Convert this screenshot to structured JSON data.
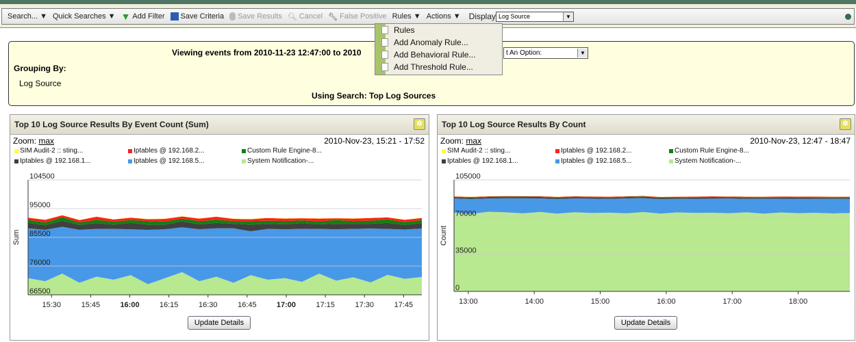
{
  "toolbar": {
    "search": "Search... ▼",
    "quick_searches": "Quick Searches ▼",
    "add_filter": "Add Filter",
    "save_criteria": "Save Criteria",
    "save_results": "Save Results",
    "cancel": "Cancel",
    "false_positive": "False Positive",
    "rules": "Rules ▼",
    "actions": "Actions ▼",
    "display_label": "Display",
    "display_value": "Log Source"
  },
  "rules_menu": {
    "items": [
      "Rules",
      "Add Anomaly Rule...",
      "Add Behavioral Rule...",
      "Add Threshold Rule..."
    ]
  },
  "info": {
    "viewing": "Viewing events from 2010-11-23 12:47:00 to 2010",
    "grouping_label": "Grouping By:",
    "grouping_value": "Log Source",
    "using_search": "Using Search: Top Log Sources",
    "option_select": "t An Option:"
  },
  "colors": {
    "yellow": "#ffff40",
    "red": "#ff2020",
    "green": "#108010",
    "dark": "#404040",
    "blue": "#4898e8",
    "lightgreen": "#b8e890"
  },
  "legend": [
    "SIM Audit-2 :: sting...",
    "Iptables @ 192.168.2...",
    "Custom Rule Engine-8...",
    "Iptables @ 192.168.1...",
    "Iptables @ 192.168.5...",
    "System Notification-..."
  ],
  "zoom_label": "Zoom:",
  "zoom_value": "max",
  "update_button": "Update Details",
  "chart_data": [
    {
      "type": "area",
      "stacked": true,
      "title": "Top 10 Log Source Results By Event Count (Sum)",
      "range_label": "2010-Nov-23, 15:21 - 17:52",
      "ylabel": "Sum",
      "ylim": [
        66500,
        104500
      ],
      "yticks": [
        "104500",
        "95000",
        "85500",
        "76000",
        "66500"
      ],
      "xticks": [
        "15:30",
        "15:45",
        "16:00",
        "16:15",
        "16:30",
        "16:45",
        "17:00",
        "17:15",
        "17:30",
        "17:45"
      ],
      "xticks_bold": [
        "16:00",
        "17:00"
      ],
      "x_start": "15:21",
      "x_end": "17:52",
      "series": [
        {
          "name": "System Notification-...",
          "color": "lightgreen",
          "values": [
            72000,
            71000,
            73500,
            70500,
            72500,
            71500,
            73000,
            70000,
            72000,
            74000,
            71000,
            72500,
            70500,
            73000,
            71500,
            72000,
            70800,
            73500,
            71200,
            72300,
            70600,
            73100,
            71800,
            72400
          ]
        },
        {
          "name": "Iptables @ 192.168.5...",
          "color": "blue",
          "values": [
            16500,
            17000,
            15500,
            17500,
            15800,
            16800,
            15200,
            18000,
            16200,
            14800,
            17200,
            16000,
            18000,
            14500,
            16800,
            16200,
            17500,
            14800,
            17000,
            16000,
            17800,
            15200,
            16300,
            16000
          ]
        },
        {
          "name": "Iptables @ 192.168.1...",
          "color": "dark",
          "values": [
            1800,
            1500,
            2000,
            1600,
            1900,
            1400,
            2100,
            1700,
            1500,
            2000,
            1600,
            1800,
            1500,
            2200,
            1700,
            1600,
            1900,
            1500,
            1800,
            1700,
            1600,
            2000,
            1500,
            1800
          ]
        },
        {
          "name": "Custom Rule Engine-8...",
          "color": "green",
          "values": [
            1000,
            900,
            1200,
            800,
            1100,
            1000,
            900,
            1200,
            1000,
            900,
            1100,
            1000,
            900,
            1200,
            1000,
            1100,
            900,
            1000,
            1200,
            900,
            1000,
            1100,
            900,
            1000
          ]
        },
        {
          "name": "Iptables @ 192.168.2...",
          "color": "red",
          "values": [
            700,
            900,
            600,
            800,
            1000,
            700,
            800,
            600,
            900,
            700,
            800,
            1000,
            700,
            600,
            900,
            800,
            700,
            900,
            600,
            800,
            900,
            700,
            800,
            700
          ]
        },
        {
          "name": "SIM Audit-2 :: sting...",
          "color": "yellow",
          "values": [
            100,
            100,
            100,
            100,
            100,
            100,
            100,
            100,
            100,
            100,
            100,
            100,
            100,
            100,
            100,
            100,
            100,
            100,
            100,
            100,
            100,
            100,
            100,
            100
          ]
        }
      ]
    },
    {
      "type": "area",
      "stacked": true,
      "title": "Top 10 Log Source Results By Count",
      "range_label": "2010-Nov-23, 12:47 - 18:47",
      "ylabel": "Count",
      "ylim": [
        0,
        105000
      ],
      "yticks": [
        "105000",
        "70000",
        "35000",
        "0"
      ],
      "xticks": [
        "13:00",
        "14:00",
        "15:00",
        "16:00",
        "17:00",
        "18:00"
      ],
      "x_start": "12:47",
      "x_end": "18:47",
      "series": [
        {
          "name": "System Notification-...",
          "color": "lightgreen",
          "values": [
            74000,
            73000,
            75000,
            74500,
            73500,
            74800,
            73200,
            74600,
            73800,
            74200,
            73500,
            74700,
            73300,
            74400,
            73900,
            74100,
            73600,
            74500,
            73200,
            74300,
            73700,
            74000,
            73400,
            73800
          ]
        },
        {
          "name": "Iptables @ 192.168.5...",
          "color": "blue",
          "values": [
            13500,
            14000,
            12500,
            13200,
            14200,
            12800,
            13800,
            13000,
            13600,
            12900,
            14100,
            13100,
            13700,
            12700,
            13400,
            13300,
            13900,
            12600,
            14000,
            13000,
            13500,
            13200,
            13800,
            13300
          ]
        },
        {
          "name": "Iptables @ 192.168.1...",
          "color": "dark",
          "values": [
            1000,
            900,
            1100,
            1000,
            900,
            1000,
            1100,
            900,
            1000,
            1000,
            900,
            1100,
            1000,
            900,
            1000,
            1100,
            900,
            1000,
            1000,
            900,
            1100,
            1000,
            900,
            1000
          ]
        },
        {
          "name": "Custom Rule Engine-8...",
          "color": "green",
          "values": [
            500,
            600,
            500,
            500,
            600,
            500,
            500,
            600,
            500,
            500,
            600,
            500,
            500,
            600,
            500,
            500,
            600,
            500,
            500,
            600,
            500,
            500,
            600,
            500
          ]
        },
        {
          "name": "Iptables @ 192.168.2...",
          "color": "red",
          "values": [
            400,
            500,
            400,
            500,
            400,
            500,
            400,
            500,
            400,
            500,
            400,
            500,
            400,
            500,
            400,
            500,
            400,
            500,
            400,
            500,
            400,
            500,
            400,
            500
          ]
        },
        {
          "name": "SIM Audit-2 :: sting...",
          "color": "yellow",
          "values": [
            100,
            100,
            100,
            100,
            100,
            100,
            100,
            100,
            100,
            100,
            100,
            100,
            100,
            100,
            100,
            100,
            100,
            100,
            100,
            100,
            100,
            100,
            100,
            100
          ]
        }
      ]
    }
  ]
}
